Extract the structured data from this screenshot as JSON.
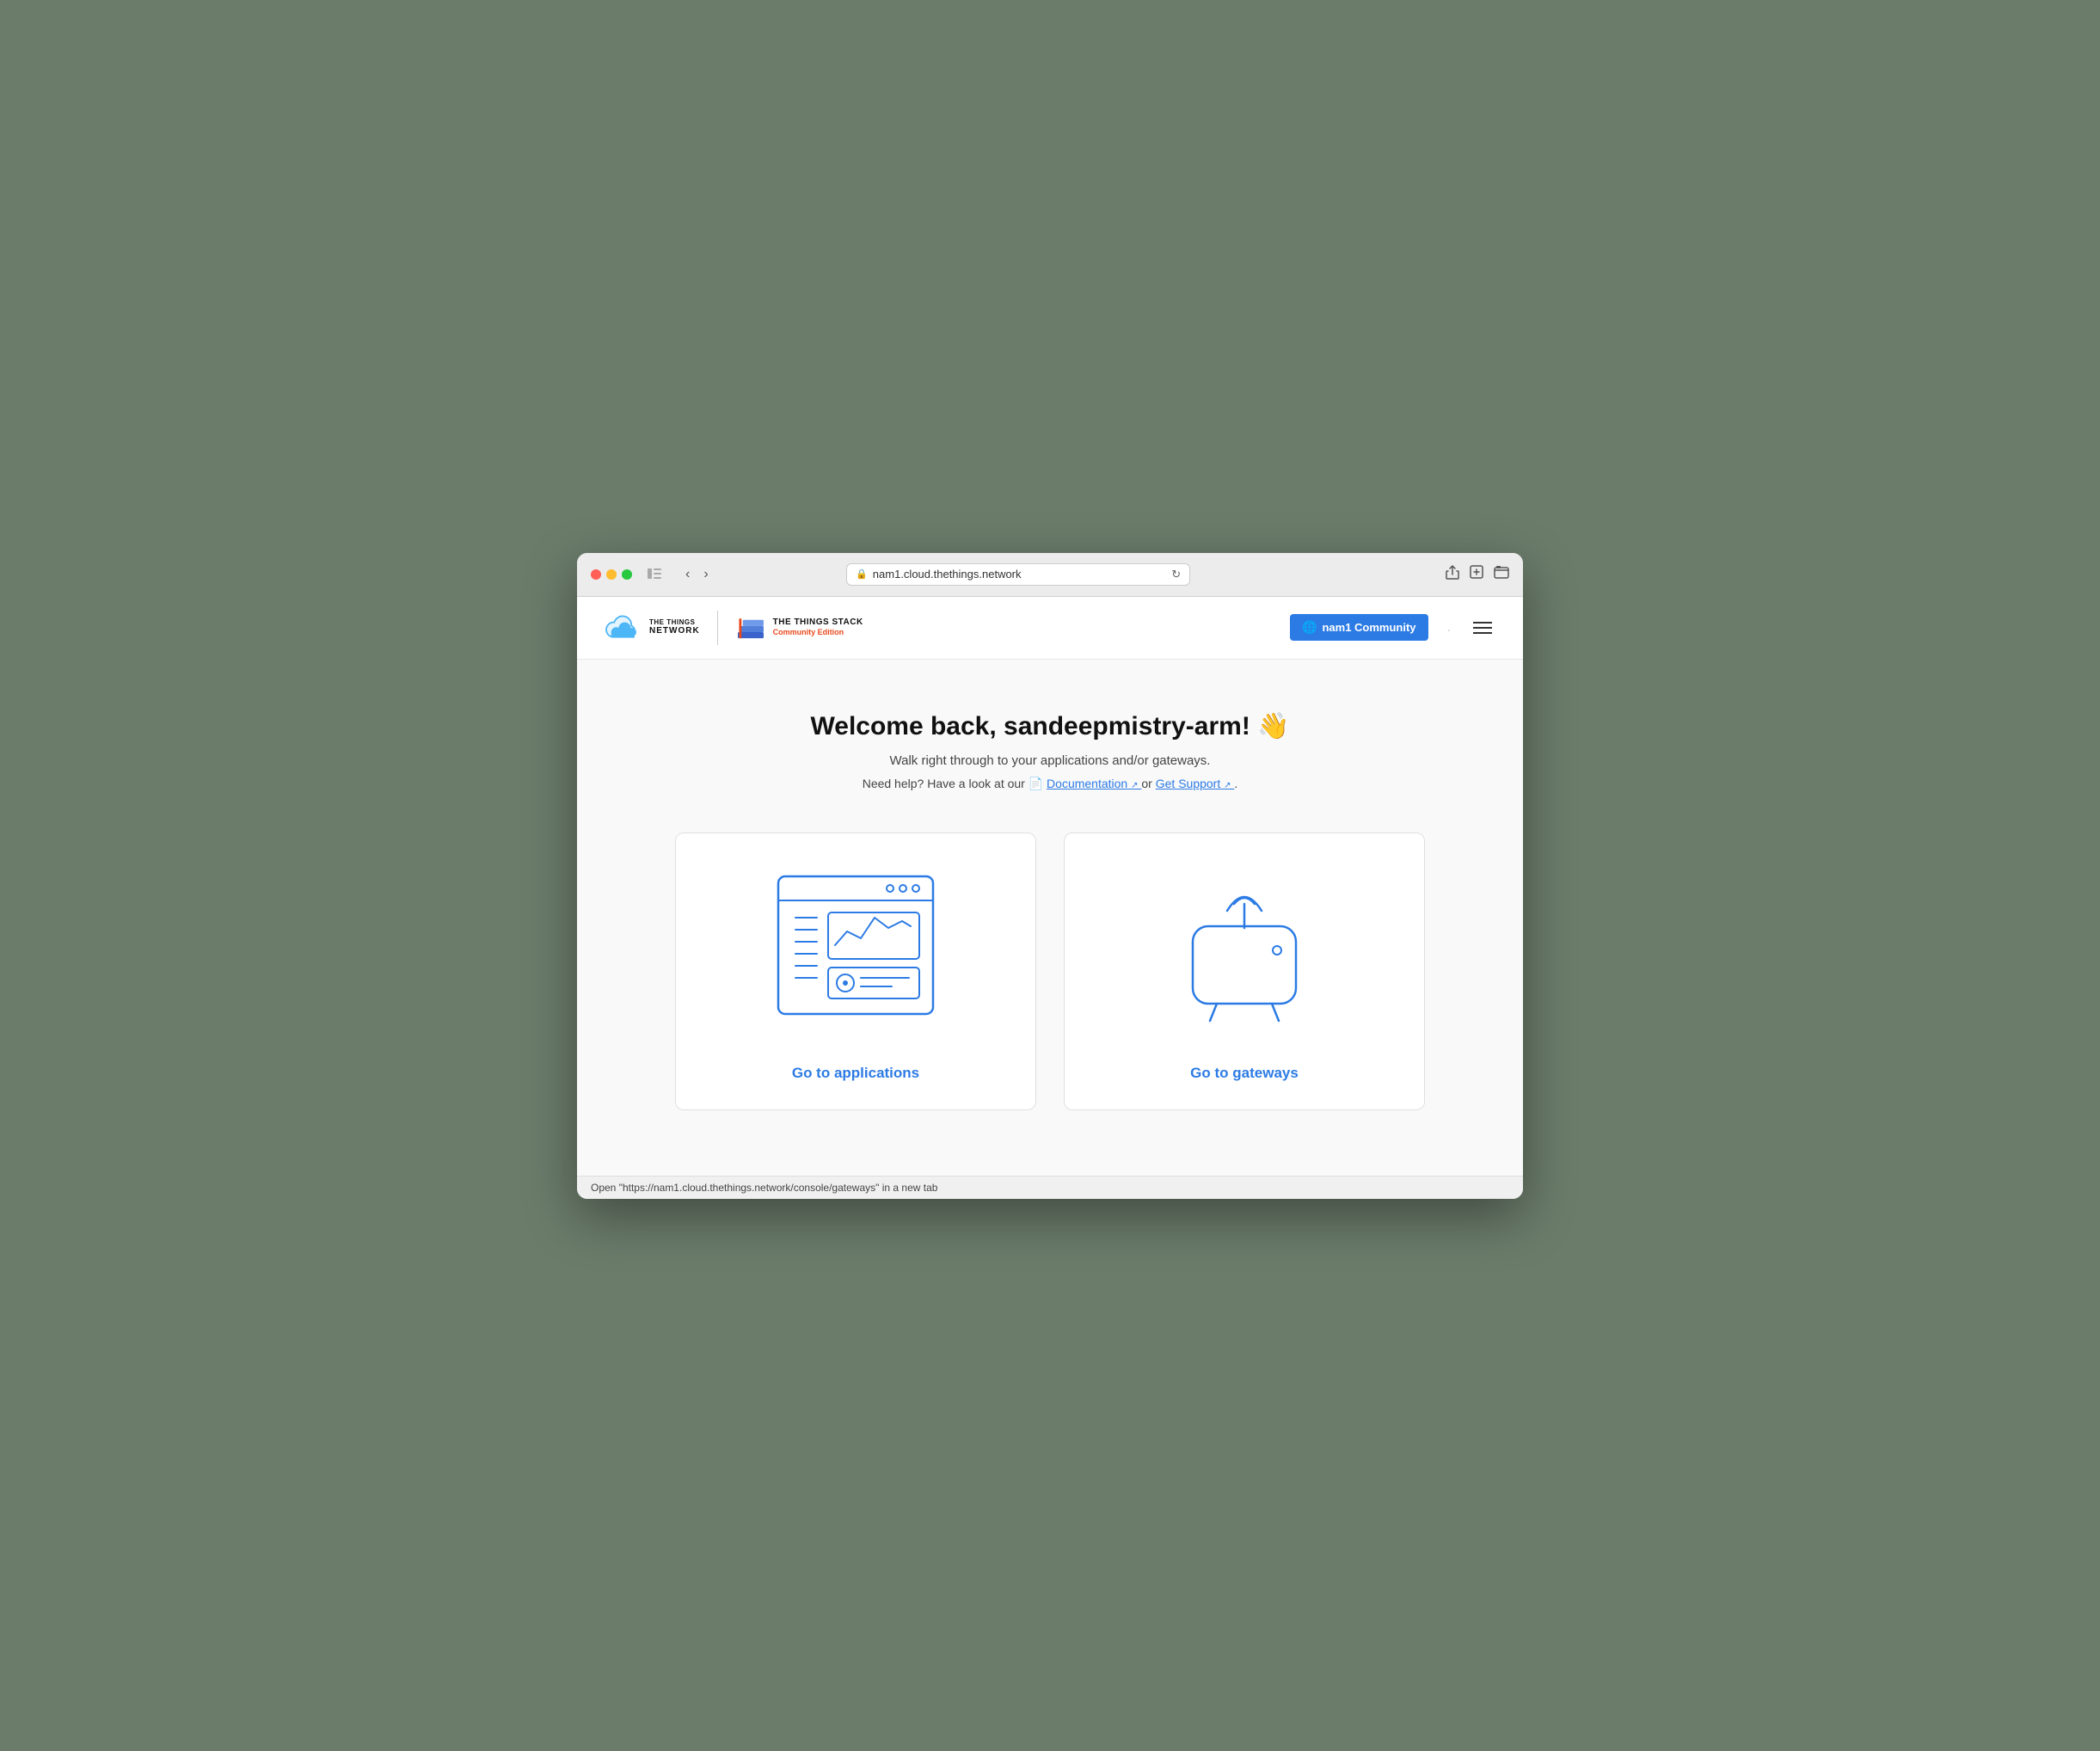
{
  "browser": {
    "url": "nam1.cloud.thethings.network",
    "back_btn": "‹",
    "forward_btn": "›"
  },
  "header": {
    "logo_ttn_line1": "THE THINGS",
    "logo_ttn_line2": "NETWORK",
    "logo_tts_line1": "THE THINGS STACK",
    "logo_tts_line2": "Community Edition",
    "cluster_btn_label": "nam1 Community",
    "dot_separator": "."
  },
  "main": {
    "welcome_title": "Welcome back, sandeepmistry-arm! 👋",
    "welcome_subtitle": "Walk right through to your applications and/or gateways.",
    "help_prefix": "Need help? Have a look at our",
    "docs_label": "Documentation",
    "help_or": "or",
    "support_label": "Get Support",
    "help_suffix": "."
  },
  "cards": [
    {
      "id": "applications",
      "label": "Go to applications"
    },
    {
      "id": "gateways",
      "label": "Go to gateways"
    }
  ],
  "status_bar": {
    "text": "Open \"https://nam1.cloud.thethings.network/console/gateways\" in a new tab"
  },
  "colors": {
    "accent": "#2c7be5",
    "orange": "#e8491d"
  }
}
